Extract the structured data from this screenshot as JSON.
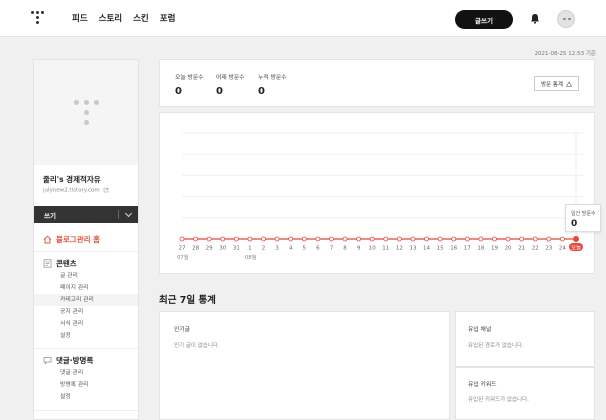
{
  "topbar": {
    "nav": [
      "피드",
      "스토리",
      "스킨",
      "포럼"
    ],
    "write_label": "글쓰기"
  },
  "datestamp": "2021-08-25 12:53 기준",
  "sidebar": {
    "blog_name": "줄리's 경제적자유",
    "blog_url": "julynew2.tistory.com",
    "write_label": "쓰기",
    "home_label": "블로그관리 홈",
    "sections": [
      {
        "title": "콘텐츠",
        "icon": "document-icon",
        "items": [
          "글 관리",
          "페이지 관리",
          "카테고리 관리",
          "공지 관리",
          "서식 관리",
          "설정"
        ]
      },
      {
        "title": "댓글·방명록",
        "icon": "comment-icon",
        "items": [
          "댓글 관리",
          "방명록 관리",
          "설정"
        ]
      }
    ],
    "active_item": "카테고리 관리"
  },
  "stats": {
    "today_label": "오늘 방문수",
    "today_value": "0",
    "yesterday_label": "어제 방문수",
    "yesterday_value": "0",
    "total_label": "누적 방문수",
    "total_value": "0",
    "visit_button": "방문 통계"
  },
  "chart_data": {
    "type": "line",
    "categories": [
      "27",
      "28",
      "29",
      "30",
      "31",
      "1",
      "2",
      "3",
      "4",
      "5",
      "6",
      "7",
      "8",
      "9",
      "10",
      "11",
      "12",
      "13",
      "14",
      "15",
      "16",
      "17",
      "18",
      "19",
      "20",
      "21",
      "22",
      "23",
      "24",
      "오늘"
    ],
    "month_labels": [
      {
        "label": "07월",
        "index": 0
      },
      {
        "label": "08월",
        "index": 5
      }
    ],
    "series": [
      {
        "values": [
          0,
          0,
          0,
          0,
          0,
          0,
          0,
          0,
          0,
          0,
          0,
          0,
          0,
          0,
          0,
          0,
          0,
          0,
          0,
          0,
          0,
          0,
          0,
          0,
          0,
          0,
          0,
          0,
          0,
          0
        ]
      }
    ],
    "line_color": "#e8453c",
    "grid": true
  },
  "tooltip": {
    "label": "일간 방문수",
    "value": "0"
  },
  "recent": {
    "title": "최근 7일 통계",
    "popular_title": "인기글",
    "popular_empty": "인기 글이 없습니다.",
    "channel_title": "유입 채널",
    "channel_empty": "유입된 경로가 없습니다.",
    "keyword_title": "유입 키워드",
    "keyword_empty": "유입된 키워드가 없습니다."
  }
}
